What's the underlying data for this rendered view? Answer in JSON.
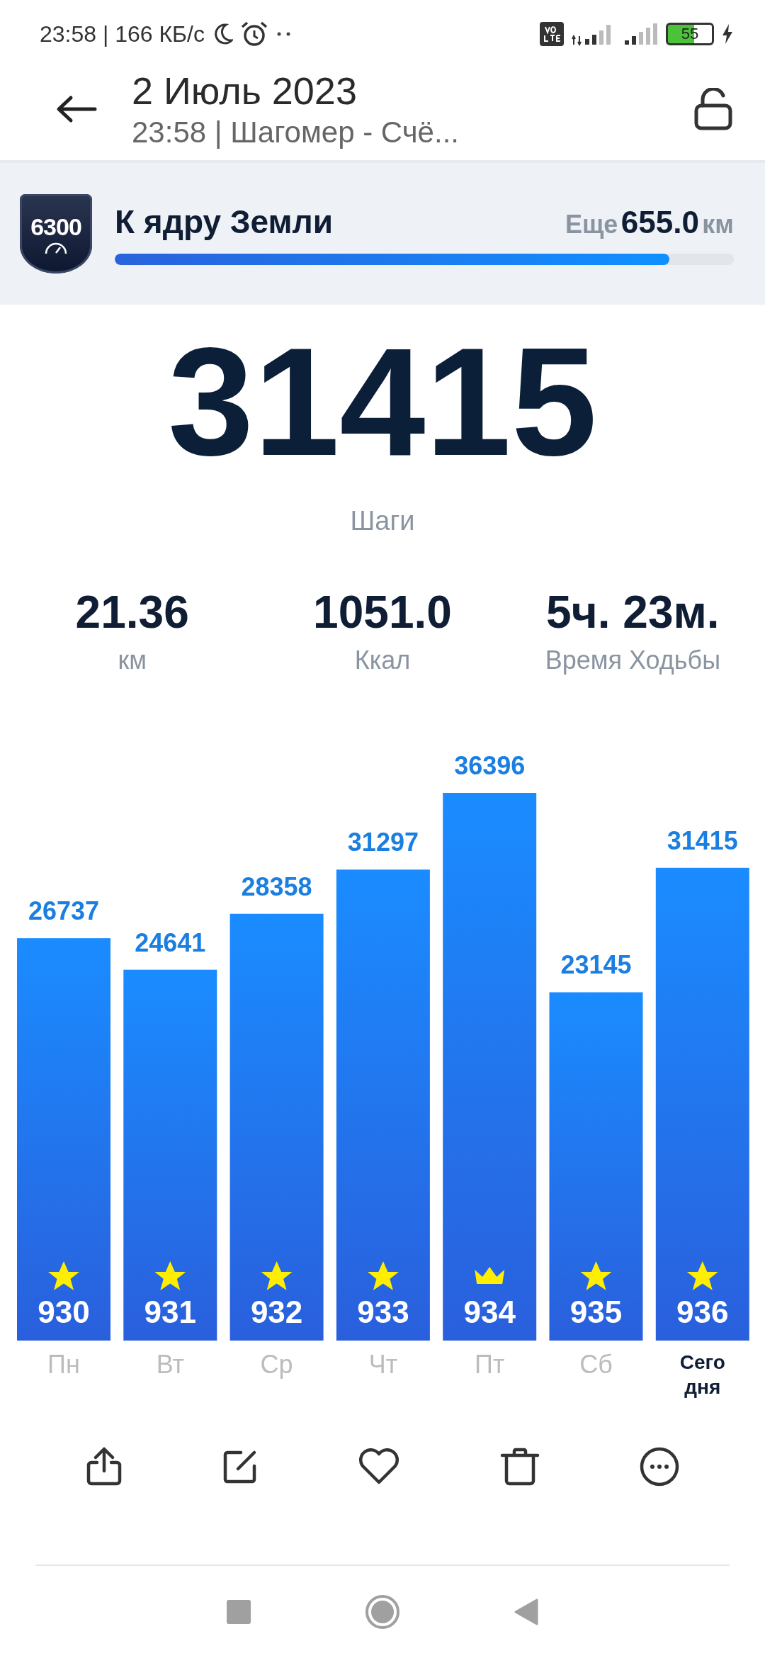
{
  "status_bar": {
    "time": "23:58 | 166 КБ/с",
    "battery": "55"
  },
  "header": {
    "title": "2 Июль 2023",
    "subtitle": "23:58 | Шагомер - Счё..."
  },
  "goal": {
    "badge": "6300",
    "title": "К ядру Земли",
    "remaining_prefix": "Еще",
    "remaining_value": "655.0",
    "remaining_unit": "км",
    "level": 0.896
  },
  "steps": {
    "value": "31415",
    "label": "Шаги"
  },
  "stats": [
    {
      "value": "21.36",
      "label": "км"
    },
    {
      "value": "1051.0",
      "label": "Ккал"
    },
    {
      "value": "5ч. 23м.",
      "label": "Время Ходьбы"
    }
  ],
  "chart_data": {
    "type": "bar",
    "categories": [
      "Пн",
      "Вт",
      "Ср",
      "Чт",
      "Пт",
      "Сб",
      "Сегодня"
    ],
    "values": [
      26737,
      24641,
      28358,
      31297,
      36396,
      23145,
      31415
    ],
    "data_labels": true
  },
  "days": [
    {
      "badge": "930",
      "kind": "star",
      "selected": false
    },
    {
      "badge": "931",
      "kind": "star",
      "selected": false
    },
    {
      "badge": "932",
      "kind": "star",
      "selected": false
    },
    {
      "badge": "933",
      "kind": "star",
      "selected": false
    },
    {
      "badge": "934",
      "kind": "crown",
      "selected": false
    },
    {
      "badge": "935",
      "kind": "star",
      "selected": false
    },
    {
      "badge": "936",
      "kind": "star",
      "selected": true
    }
  ]
}
